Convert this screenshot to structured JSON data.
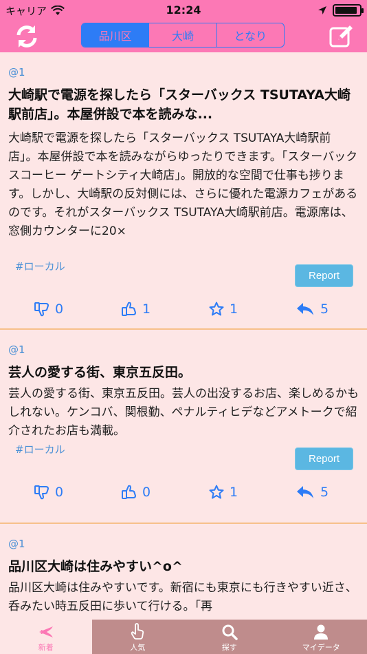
{
  "status_bar": {
    "carrier": "キャリア",
    "time": "12:24",
    "battery_level": 0.9
  },
  "navbar": {
    "segments": [
      {
        "label": "品川区",
        "active": true
      },
      {
        "label": "大崎",
        "active": false
      },
      {
        "label": "となり",
        "active": false
      }
    ],
    "refresh_icon": "refresh-icon",
    "compose_icon": "compose-icon"
  },
  "posts": [
    {
      "user": "@1",
      "title": "大崎駅で電源を探したら「スターバックス TSUTAYA大崎駅前店」。本屋併設で本を読みな...",
      "body": "大崎駅で電源を探したら「スターバックス TSUTAYA大崎駅前店」。本屋併設で本を読みながらゆったりできます。「スターバックスコーヒー ゲートシティ大崎店」。開放的な空間で仕事も捗ります。しかし、大崎駅の反対側には、さらに優れた電源カフェがあるのです。それがスターバックス TSUTAYA大崎駅前店。電源席は、窓側カウンターに20×",
      "tag": "#ローカル",
      "report_label": "Report",
      "dislikes": "0",
      "likes": "1",
      "stars": "1",
      "replies": "5"
    },
    {
      "user": "@1",
      "title": "芸人の愛する街、東京五反田。",
      "body": "芸人の愛する街、東京五反田。芸人の出没するお店、楽しめるかもしれない。ケンコバ、関根勤、ペナルティヒデなどアメトークで紹介されたお店も満載。",
      "tag": "#ローカル",
      "report_label": "Report",
      "dislikes": "0",
      "likes": "0",
      "stars": "1",
      "replies": "5"
    },
    {
      "user": "@1",
      "title": "品川区大崎は住みやすい^o^",
      "body": "品川区大崎は住みやすいです。新宿にも東京にも行きやすい近さ、呑みたい時五反田に歩いて行ける。「再"
    }
  ],
  "tabbar": {
    "tabs": [
      {
        "label": "新着",
        "icon": "airplane-icon",
        "active": true
      },
      {
        "label": "人気",
        "icon": "tap-hand-icon",
        "active": false
      },
      {
        "label": "探す",
        "icon": "search-icon",
        "active": false
      },
      {
        "label": "マイデータ",
        "icon": "user-icon",
        "active": false
      }
    ]
  },
  "colors": {
    "header_pink": "#fc78b5",
    "feed_background": "#fde6e6",
    "accent_blue": "#2d7cf6",
    "report_button": "#5bb7e2",
    "separator": "#f7c08a",
    "tabbar_inactive": "#bf8c8c"
  }
}
